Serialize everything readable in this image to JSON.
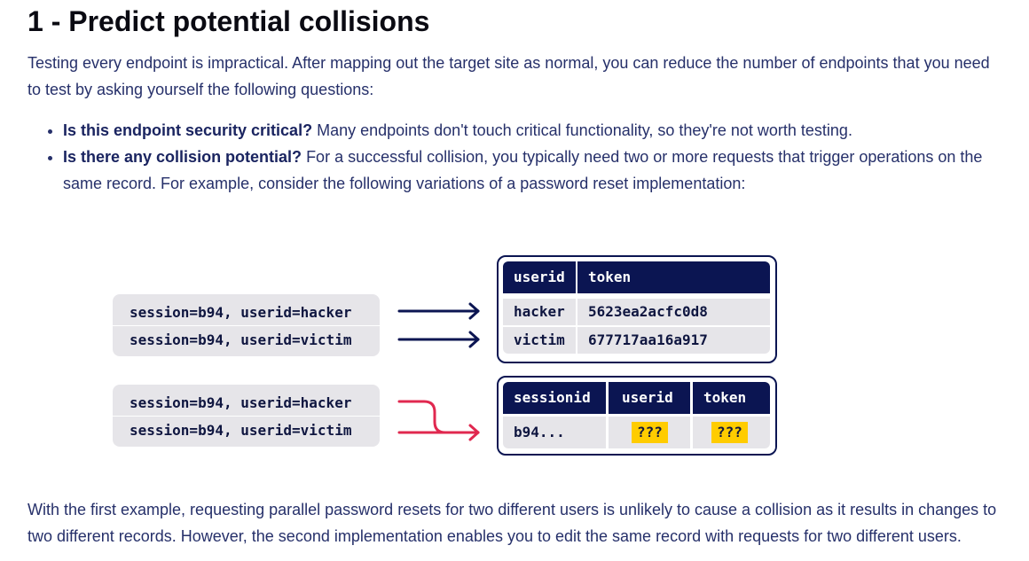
{
  "heading": "1 - Predict potential collisions",
  "intro": "Testing every endpoint is impractical. After mapping out the target site as normal, you can reduce the number of endpoints that you need to test by asking yourself the following questions:",
  "bullets": [
    {
      "bold": "Is this endpoint security critical?",
      "text": " Many endpoints don't touch critical functionality, so they're not worth testing."
    },
    {
      "bold": "Is there any collision potential?",
      "text": " For a successful collision, you typically need two or more requests that trigger operations on the same record. For example, consider the following variations of a password reset implementation:"
    }
  ],
  "diagram": {
    "example1": {
      "requests": [
        "session=b94, userid=hacker",
        "session=b94, userid=victim"
      ],
      "table": {
        "headers": [
          "userid",
          "token"
        ],
        "rows": [
          [
            "hacker",
            "5623ea2acfc0d8"
          ],
          [
            "victim",
            "677717aa16a917"
          ]
        ]
      }
    },
    "example2": {
      "requests": [
        "session=b94, userid=hacker",
        "session=b94, userid=victim"
      ],
      "table": {
        "headers": [
          "sessionid",
          "userid",
          "token"
        ],
        "rows": [
          [
            "b94...",
            "???",
            "???"
          ]
        ]
      }
    },
    "colors": {
      "navy": "#0b1552",
      "red": "#e0284f",
      "highlight": "#ffcc00",
      "cell": "#e6e5e9"
    }
  },
  "conclusion": "With the first example, requesting parallel password resets for two different users is unlikely to cause a collision as it results in changes to two different records. However, the second implementation enables you to edit the same record with requests for two different users."
}
